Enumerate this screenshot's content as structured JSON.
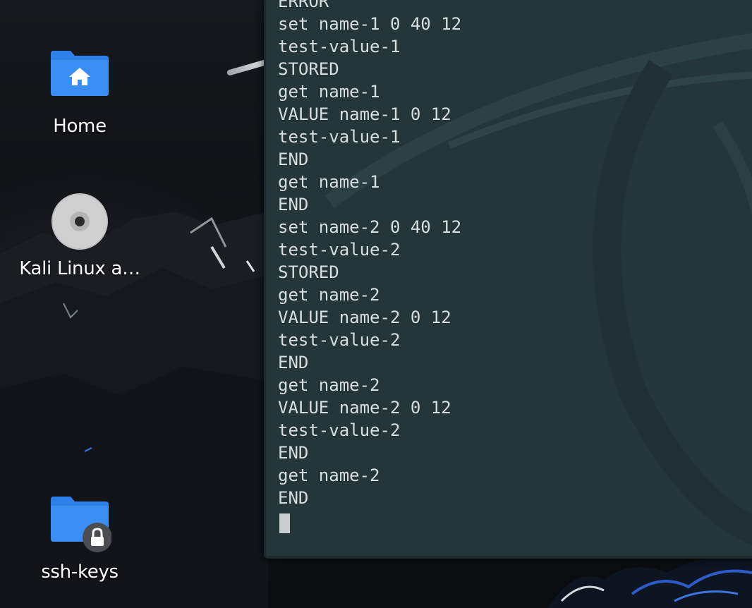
{
  "desktop": {
    "icons": [
      {
        "label": "Home",
        "icon": "home-folder-icon"
      },
      {
        "label": "Kali Linux a…",
        "icon": "optical-disc-icon"
      },
      {
        "label": "ssh-keys",
        "icon": "locked-folder-icon"
      }
    ]
  },
  "terminal": {
    "lines": [
      "ERROR",
      "set name-1 0 40 12",
      "test-value-1",
      "STORED",
      "get name-1",
      "VALUE name-1 0 12",
      "test-value-1",
      "END",
      "get name-1",
      "END",
      "set name-2 0 40 12",
      "test-value-2",
      "STORED",
      "get name-2",
      "VALUE name-2 0 12",
      "test-value-2",
      "END",
      "get name-2",
      "VALUE name-2 0 12",
      "test-value-2",
      "END",
      "get name-2",
      "END"
    ]
  },
  "colors": {
    "folder_blue": "#2f7fe8",
    "terminal_bg": "#253638",
    "terminal_text": "#d8dede"
  }
}
